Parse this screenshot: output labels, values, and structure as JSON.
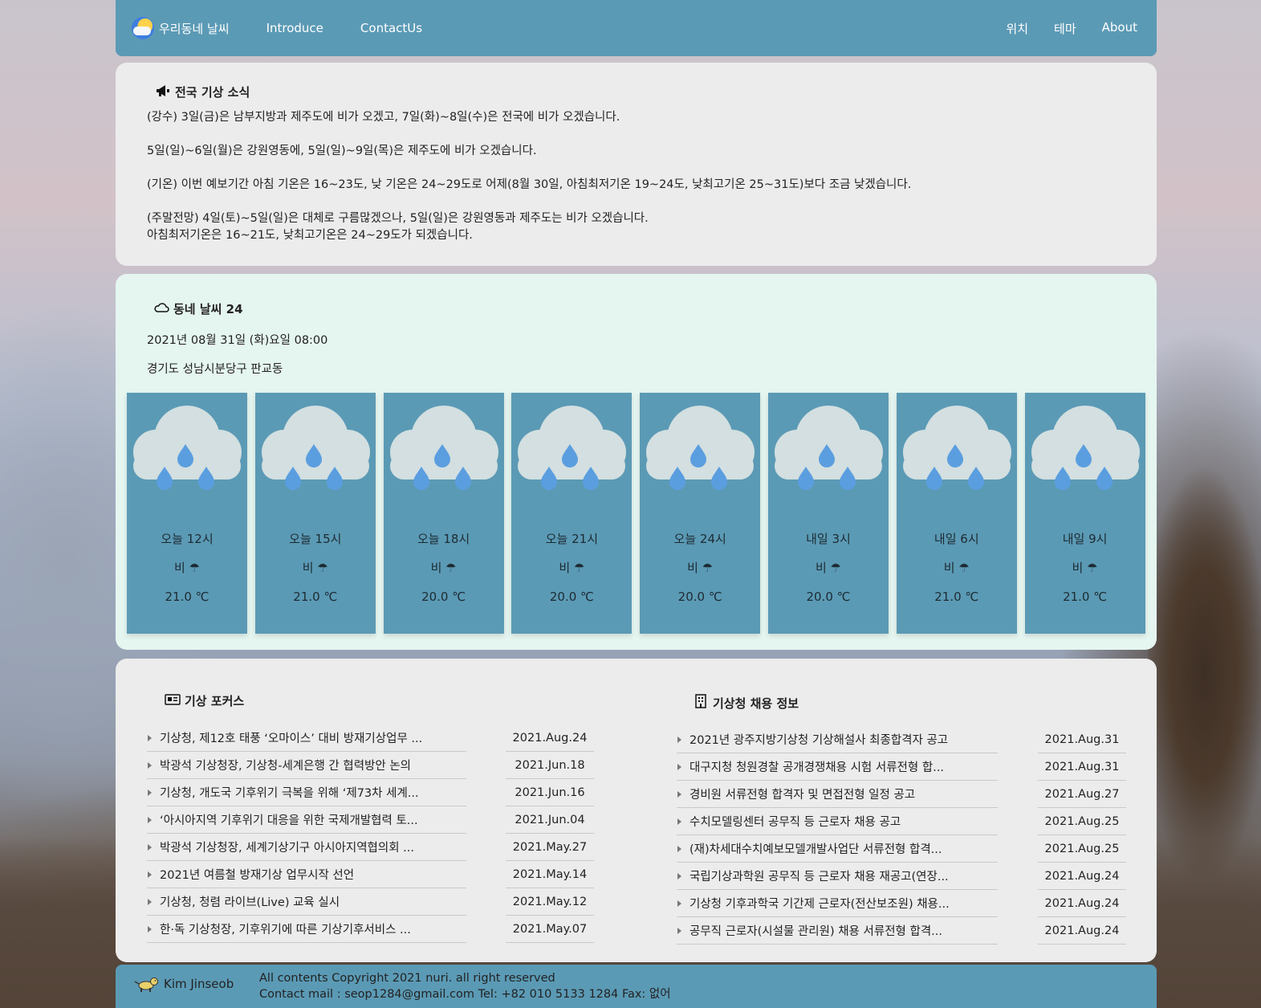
{
  "nav": {
    "brand": "우리동네 날씨",
    "links": [
      "Introduce",
      "ContactUs"
    ],
    "right_links": [
      "위치",
      "테마",
      "About"
    ],
    "color": "#5b9ab5"
  },
  "news": {
    "title": "전국 기상 소식",
    "icon": "megaphone-icon",
    "lines": [
      "(강수) 3일(금)은 남부지방과 제주도에 비가 오겠고, 7일(화)~8일(수)은 전국에 비가 오겠습니다.",
      "5일(일)~6일(월)은 강원영동에, 5일(일)~9일(목)은 제주도에 비가 오겠습니다.",
      "(기온) 이번 예보기간 아침 기온은 16~23도, 낮 기온은 24~29도로 어제(8월 30일, 아침최저기온 19~24도, 낮최고기온 25~31도)보다 조금 낮겠습니다.",
      "(주말전망) 4일(토)~5일(일)은 대체로 구름많겠으나, 5일(일)은 강원영동과 제주도는 비가 오겠습니다.",
      "아침최저기온은 16~21도, 낮최고기온은 24~29도가 되겠습니다."
    ]
  },
  "weather": {
    "title": "동네 날씨 24",
    "icon": "cloud-icon",
    "datetime": "2021년 08월 31일 (화)요일 08:00",
    "location": "경기도 성남시분당구 판교동",
    "forecast": [
      {
        "time": "오늘 12시",
        "cond": "비",
        "temp": "21.0 ℃"
      },
      {
        "time": "오늘 15시",
        "cond": "비",
        "temp": "21.0 ℃"
      },
      {
        "time": "오늘 18시",
        "cond": "비",
        "temp": "20.0 ℃"
      },
      {
        "time": "오늘 21시",
        "cond": "비",
        "temp": "20.0 ℃"
      },
      {
        "time": "오늘 24시",
        "cond": "비",
        "temp": "20.0 ℃"
      },
      {
        "time": "내일 3시",
        "cond": "비",
        "temp": "20.0 ℃"
      },
      {
        "time": "내일 6시",
        "cond": "비",
        "temp": "21.0 ℃"
      },
      {
        "time": "내일 9시",
        "cond": "비",
        "temp": "21.0 ℃"
      }
    ]
  },
  "focus": {
    "title": "기상 포커스",
    "icon": "newspaper-icon",
    "items": [
      {
        "title": "기상청, 제12호 태풍 ‘오마이스’ 대비 방재기상업무 ...",
        "date": "2021.Aug.24"
      },
      {
        "title": "박광석 기상청장, 기상청-세계은행 간 협력방안 논의",
        "date": "2021.Jun.18"
      },
      {
        "title": "기상청, 개도국 기후위기 극복을 위해 ‘제73차 세계...",
        "date": "2021.Jun.16"
      },
      {
        "title": "‘아시아지역 기후위기 대응을 위한 국제개발협력 토...",
        "date": "2021.Jun.04"
      },
      {
        "title": "박광석 기상청장, 세계기상기구 아시아지역협의회 ...",
        "date": "2021.May.27"
      },
      {
        "title": "2021년 여름철 방재기상 업무시작 선언",
        "date": "2021.May.14"
      },
      {
        "title": "기상청, 청렴 라이브(Live) 교육 실시",
        "date": "2021.May.12"
      },
      {
        "title": "한·독 기상청장, 기후위기에 따른 기상기후서비스 ...",
        "date": "2021.May.07"
      }
    ]
  },
  "jobs": {
    "title": "기상청 채용 정보",
    "icon": "building-icon",
    "items": [
      {
        "title": "2021년 광주지방기상청 기상해설사 최종합격자 공고",
        "date": "2021.Aug.31"
      },
      {
        "title": "대구지청 청원경찰 공개경쟁채용 시험 서류전형 합...",
        "date": "2021.Aug.31"
      },
      {
        "title": "경비원 서류전형 합격자 및 면접전형 일정 공고",
        "date": "2021.Aug.27"
      },
      {
        "title": "수치모델링센터 공무직 등 근로자 채용 공고",
        "date": "2021.Aug.25"
      },
      {
        "title": "(재)차세대수치예보모델개발사업단 서류전형 합격...",
        "date": "2021.Aug.25"
      },
      {
        "title": "국립기상과학원 공무직 등 근로자 채용 재공고(연장...",
        "date": "2021.Aug.24"
      },
      {
        "title": "기상청 기후과학국 기간제 근로자(전산보조원) 채용...",
        "date": "2021.Aug.24"
      },
      {
        "title": "공무직 근로자(시설물 관리원) 채용 서류전형 합격...",
        "date": "2021.Aug.24"
      }
    ]
  },
  "footer": {
    "name": "Kim Jinseob",
    "copyright": "All contents Copyright 2021 nuri. all right reserved",
    "contact": "Contact mail : seop1284@gmail.com Tel: +82 010 5133 1284 Fax: 없어"
  }
}
